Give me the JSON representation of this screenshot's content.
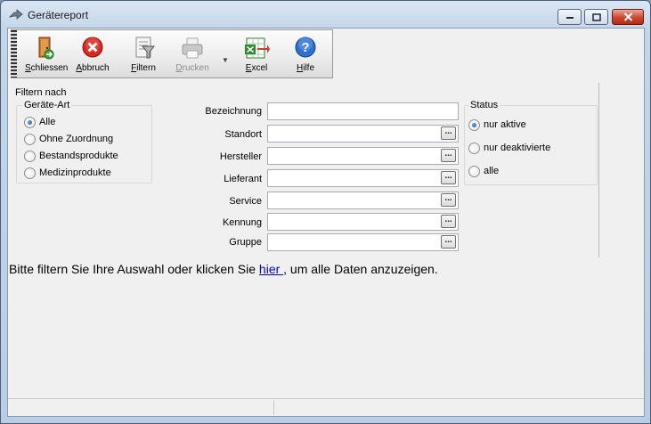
{
  "window": {
    "title": "Gerätereport"
  },
  "toolbar": {
    "buttons": [
      {
        "key": "schliessen",
        "first": "S",
        "rest": "chliessen",
        "enabled": true
      },
      {
        "key": "abbruch",
        "first": "A",
        "rest": "bbruch",
        "enabled": true
      },
      {
        "key": "filtern",
        "first": "F",
        "rest": "iltern",
        "enabled": true
      },
      {
        "key": "drucken",
        "first": "D",
        "rest": "rucken",
        "enabled": false
      },
      {
        "key": "excel",
        "first": "E",
        "rest": "xcel",
        "enabled": true
      },
      {
        "key": "hilfe",
        "first": "H",
        "rest": "ilfe",
        "enabled": true
      }
    ]
  },
  "filter": {
    "section_title": "Filtern nach",
    "geraete_art": {
      "title": "Geräte-Art",
      "options": [
        "Alle",
        "Ohne Zuordnung",
        "Bestandsprodukte",
        "Medizinprodukte"
      ],
      "selected": "Alle"
    },
    "fields": {
      "bezeichnung": {
        "label": "Bezeichnung",
        "value": ""
      },
      "standort": {
        "label": "Standort",
        "value": ""
      },
      "hersteller": {
        "label": "Hersteller",
        "value": ""
      },
      "lieferant": {
        "label": "Lieferant",
        "value": ""
      },
      "service": {
        "label": "Service",
        "value": ""
      },
      "kennung": {
        "label": "Kennung",
        "value": ""
      },
      "gruppe": {
        "label": "Gruppe",
        "value": ""
      }
    },
    "lookup_button_label": "...",
    "status": {
      "title": "Status",
      "options": [
        "nur aktive",
        "nur deaktivierte",
        "alle"
      ],
      "selected": "nur aktive"
    }
  },
  "message": {
    "before": "Bitte filtern Sie Ihre Auswahl oder klicken Sie ",
    "link": " hier ",
    "after": ", um alle Daten anzuzeigen."
  },
  "colors": {
    "link": "#0000cc",
    "close_button": "#c9462f",
    "disabled_text": "#8c8c8c"
  }
}
